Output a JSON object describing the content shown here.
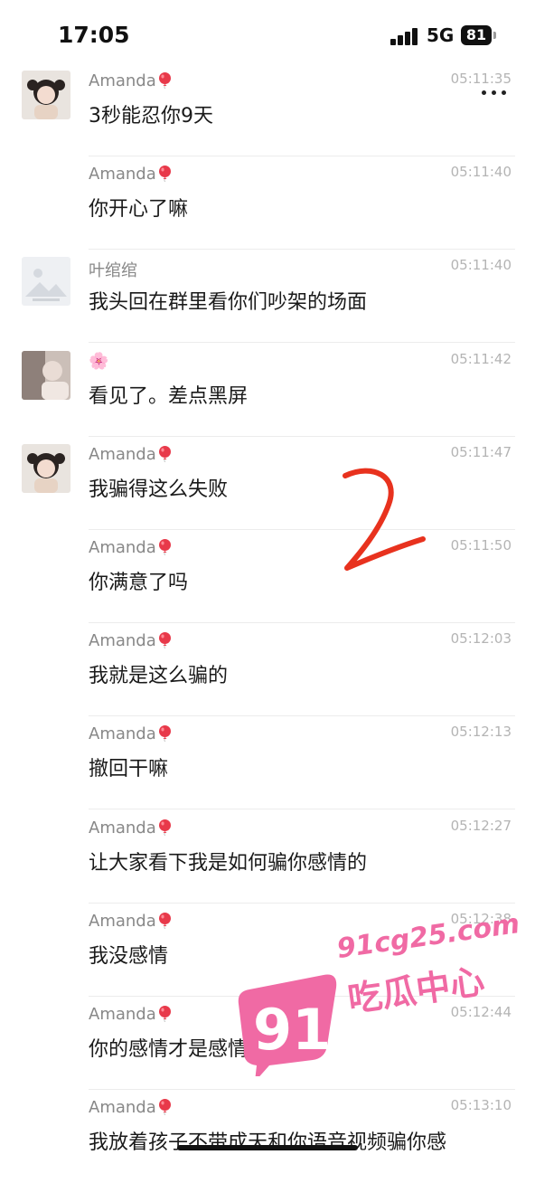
{
  "status_bar": {
    "time": "17:05",
    "network": "5G",
    "battery": "81"
  },
  "messages": [
    {
      "sender": "Amanda",
      "time": "05:11:35",
      "text": "3秒能忍你9天",
      "avatar": "girl"
    },
    {
      "sender": "Amanda",
      "time": "05:11:40",
      "text": "你开心了嘛",
      "avatar": "none"
    },
    {
      "sender": "叶绾绾",
      "time": "05:11:40",
      "text": "我头回在群里看你们吵架的场面",
      "avatar": "placeholder"
    },
    {
      "sender": "🌸",
      "time": "05:11:42",
      "text": "看见了。差点黑屏",
      "avatar": "photo"
    },
    {
      "sender": "Amanda",
      "time": "05:11:47",
      "text": "我骗得这么失败",
      "avatar": "girl"
    },
    {
      "sender": "Amanda",
      "time": "05:11:50",
      "text": "你满意了吗",
      "avatar": "none"
    },
    {
      "sender": "Amanda",
      "time": "05:12:03",
      "text": "我就是这么骗的",
      "avatar": "none"
    },
    {
      "sender": "Amanda",
      "time": "05:12:13",
      "text": "撤回干嘛",
      "avatar": "none"
    },
    {
      "sender": "Amanda",
      "time": "05:12:27",
      "text": "让大家看下我是如何骗你感情的",
      "avatar": "none"
    },
    {
      "sender": "Amanda",
      "time": "05:12:38",
      "text": "我没感情",
      "avatar": "none"
    },
    {
      "sender": "Amanda",
      "time": "05:12:44",
      "text": "你的感情才是感情",
      "avatar": "none"
    },
    {
      "sender": "Amanda",
      "time": "05:13:10",
      "text": "我放着孩子不带成天和你语音视频骗你感",
      "avatar": "none"
    }
  ],
  "watermark": {
    "number": "91",
    "url": "91cg25.com",
    "name": "吃瓜中心"
  },
  "annotation": {
    "mark": "2"
  },
  "colors": {
    "balloon": "#e8394a",
    "watermark": "#f06aa4",
    "annotation": "#e8321e"
  }
}
